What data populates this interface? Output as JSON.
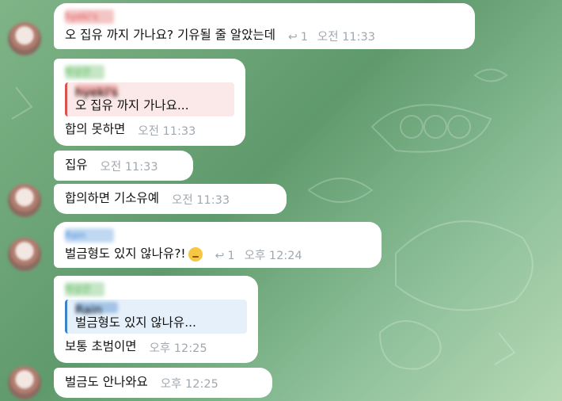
{
  "messages": [
    {
      "sender": "hyeki's",
      "text": "오 집유 까지 가나요? 기유될 줄 알았는데",
      "reply_count": "1",
      "time": "오전 11:33"
    },
    {
      "sender": "박상은",
      "reply_sender": "hyeki's",
      "reply_text": "오 집유 까지 가나요...",
      "text": "합의 못하면",
      "time": "오전 11:33"
    },
    {
      "text": "집유",
      "time": "오전 11:33"
    },
    {
      "text": "합의하면 기소유예",
      "time": "오전 11:33"
    },
    {
      "sender": "Rain",
      "text": "벌금형도 있지 않나유?!",
      "reply_count": "1",
      "time": "오후 12:24"
    },
    {
      "sender": "박상은",
      "reply_sender": "Rain",
      "reply_text": "벌금형도 있지 않나유...",
      "text": "보통 초범이면",
      "time": "오후 12:25"
    },
    {
      "text": "벌금도 안나와요",
      "time": "오후 12:25"
    }
  ],
  "icons": {
    "reply": "reply-arrow-icon",
    "emoji": "thinking-face-emoji"
  }
}
